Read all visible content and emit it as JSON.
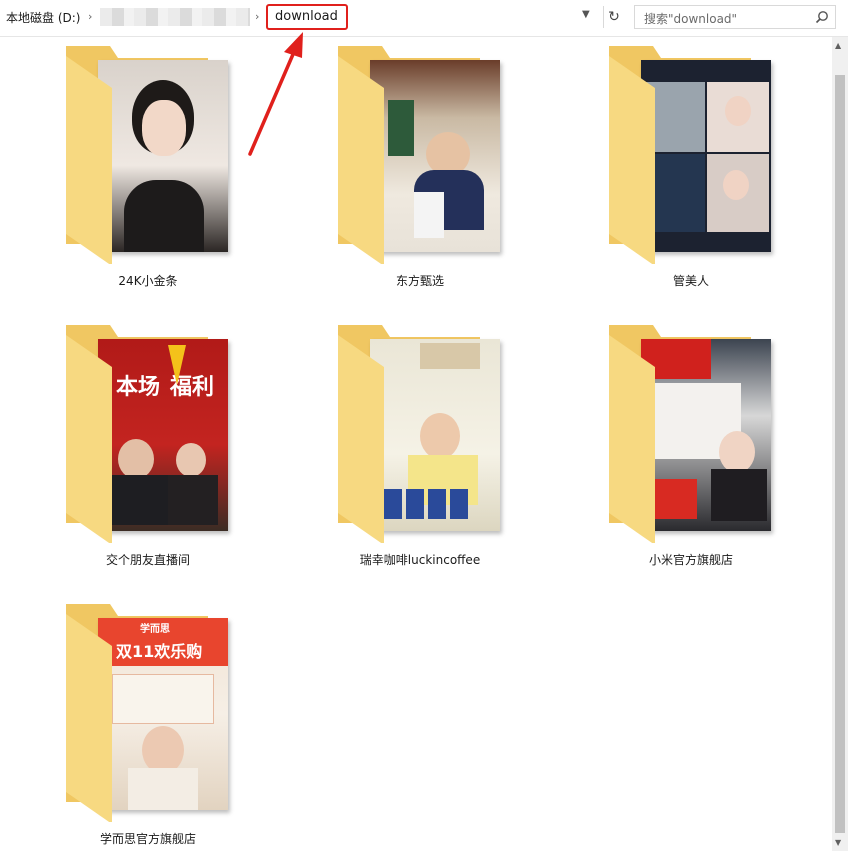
{
  "address_bar": {
    "root": "本地磁盘 (D:)",
    "current": "download",
    "search_placeholder": "搜索\"download\""
  },
  "folders": [
    {
      "name": "24K小金条"
    },
    {
      "name": "东方甄选"
    },
    {
      "name": "管美人"
    },
    {
      "name": "交个朋友直播间",
      "thumb_text_1": "本场",
      "thumb_text_2": "福利"
    },
    {
      "name": "瑞幸咖啡luckincoffee"
    },
    {
      "name": "小米官方旗舰店"
    },
    {
      "name": "学而思官方旗舰店",
      "thumb_text_1": "双11欢乐购",
      "thumb_text_2": "学而思"
    }
  ],
  "colors": {
    "highlight": "#e0201c",
    "folder_back": "#f0c762",
    "folder_front": "#f7d981"
  }
}
